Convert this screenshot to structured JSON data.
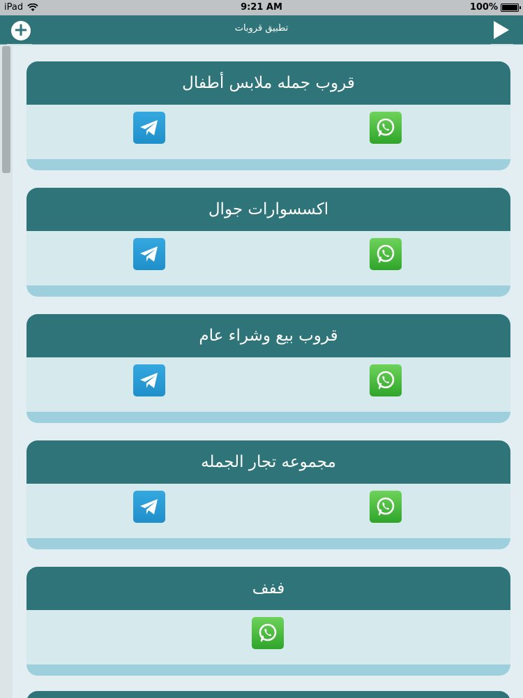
{
  "status_bar": {
    "carrier": "iPad",
    "time": "9:21 AM",
    "battery": "100%",
    "battery_level": 1.0
  },
  "nav": {
    "title": "تطبيق قروبات"
  },
  "colors": {
    "header": "#2f7478",
    "card_body": "#d6eaee",
    "card_footer": "#9dd0dc",
    "whatsapp": "#3fb536",
    "telegram": "#2a9bd6"
  },
  "groups": [
    {
      "title": "قروب جمله ملابس أطفال",
      "whatsapp": true,
      "telegram": true
    },
    {
      "title": "اكسسوارات جوال",
      "whatsapp": true,
      "telegram": true
    },
    {
      "title": "قروب بيع وشراء عام",
      "whatsapp": true,
      "telegram": true
    },
    {
      "title": "مجموعه تجار الجمله",
      "whatsapp": true,
      "telegram": true
    },
    {
      "title": "ففف",
      "whatsapp": true,
      "telegram": false
    }
  ]
}
